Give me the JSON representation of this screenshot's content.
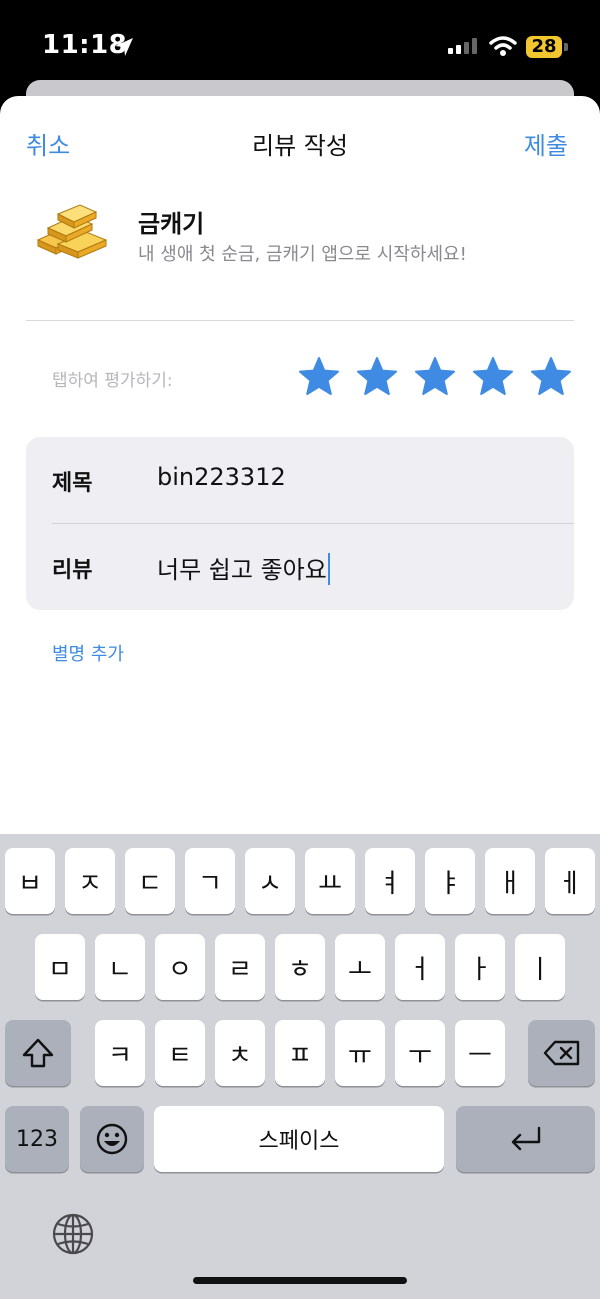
{
  "status_bar": {
    "time": "11:18",
    "battery": "28"
  },
  "nav": {
    "cancel": "취소",
    "title": "리뷰 작성",
    "submit": "제출"
  },
  "app": {
    "name": "금캐기",
    "subtitle": "내 생애 첫 순금, 금캐기 앱으로 시작하세요!"
  },
  "rating": {
    "prompt": "탭하여 평가하기:",
    "value": 5,
    "max": 5
  },
  "form": {
    "title_label": "제목",
    "title_value": "bin223312",
    "review_label": "리뷰",
    "review_value": "너무 쉽고 좋아요"
  },
  "alias_link": "별명 추가",
  "keyboard": {
    "row1": [
      "ㅂ",
      "ㅈ",
      "ㄷ",
      "ㄱ",
      "ㅅ",
      "ㅛ",
      "ㅕ",
      "ㅑ",
      "ㅐ",
      "ㅔ"
    ],
    "row2": [
      "ㅁ",
      "ㄴ",
      "ㅇ",
      "ㄹ",
      "ㅎ",
      "ㅗ",
      "ㅓ",
      "ㅏ",
      "ㅣ"
    ],
    "row3": [
      "ㅋ",
      "ㅌ",
      "ㅊ",
      "ㅍ",
      "ㅠ",
      "ㅜ",
      "ㅡ"
    ],
    "numbers": "123",
    "space": "스페이스"
  },
  "colors": {
    "accent": "#3f8be3",
    "star": "#3f8be3"
  }
}
